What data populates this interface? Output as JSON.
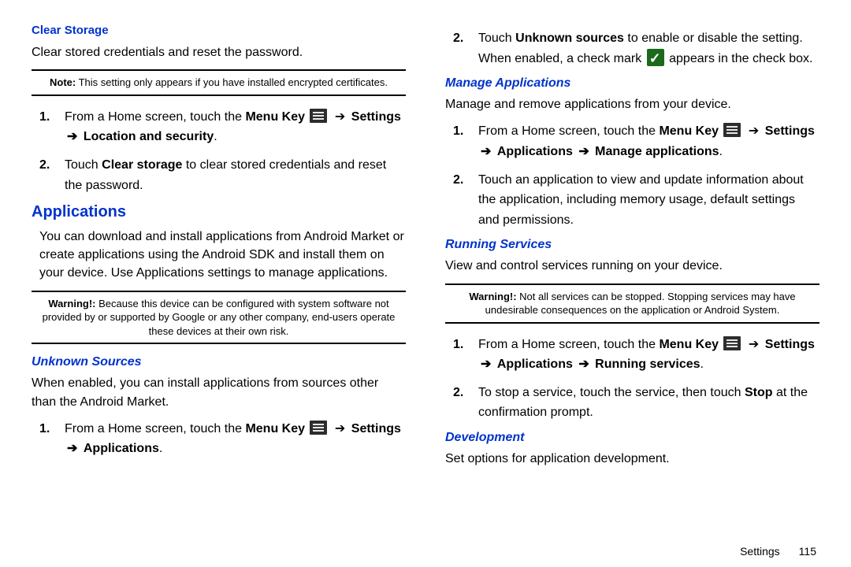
{
  "left": {
    "clearStorage": {
      "heading": "Clear Storage",
      "desc": "Clear stored credentials and reset the password.",
      "noteLabel": "Note:",
      "noteText": " This setting only appears if you have installed encrypted certificates.",
      "step1_a": "From a Home screen, touch the ",
      "step1_menuKey": "Menu Key",
      "step1_arrow1": " ➔ ",
      "step1_settings": "Settings",
      "step1_arrow2": "➔ ",
      "step1_location": "Location and security",
      "step1_period": ".",
      "step2_a": "Touch ",
      "step2_b": "Clear storage",
      "step2_c": " to clear stored credentials and reset the password."
    },
    "applications": {
      "heading": "Applications",
      "desc": "You can download and install applications from Android Market or create applications using the Android SDK and install them on your device. Use Applications settings to manage applications.",
      "warnLabel": "Warning!:",
      "warnText": " Because this device can be configured with system software not provided by or supported by Google or any other company, end-users operate these devices at their own risk."
    },
    "unknown": {
      "heading": "Unknown Sources",
      "desc": "When enabled, you can install applications from sources other than the Android Market.",
      "step1_a": "From a Home screen, touch the ",
      "step1_menuKey": "Menu Key",
      "step1_arrow1": " ➔ ",
      "step1_settings": "Settings",
      "step1_arrow2": "➔ ",
      "step1_apps": "Applications",
      "step1_period": "."
    }
  },
  "right": {
    "unknown_cont": {
      "step2_a": "Touch ",
      "step2_b": "Unknown sources",
      "step2_c": " to enable or disable the setting. When enabled, a check mark ",
      "step2_d": " appears in the check box."
    },
    "manage": {
      "heading": "Manage Applications",
      "desc": "Manage and remove applications from your device.",
      "step1_a": "From a Home screen, touch the ",
      "step1_menuKey": "Menu Key",
      "step1_arrow1": " ➔ ",
      "step1_settings": "Settings",
      "step1_arrow2": "➔ ",
      "step1_apps": "Applications",
      "step1_arrow3": " ➔ ",
      "step1_manage": "Manage applications",
      "step1_period": ".",
      "step2": "Touch an application to view and update information about the application, including memory usage, default settings and permissions."
    },
    "running": {
      "heading": "Running Services",
      "desc": "View and control services running on your device.",
      "warnLabel": "Warning!:",
      "warnText": " Not all services can be stopped. Stopping services may have undesirable consequences on the application or Android System.",
      "step1_a": "From a Home screen, touch the ",
      "step1_menuKey": "Menu Key",
      "step1_arrow1": " ➔ ",
      "step1_settings": "Settings",
      "step1_arrow2": "➔ ",
      "step1_apps": "Applications",
      "step1_arrow3": " ➔ ",
      "step1_run": "Running services",
      "step1_period": ".",
      "step2_a": "To stop a service, touch the service, then touch ",
      "step2_b": "Stop",
      "step2_c": " at the confirmation prompt."
    },
    "development": {
      "heading": "Development",
      "desc": "Set options for application development."
    }
  },
  "footer": {
    "section": "Settings",
    "page": "115"
  }
}
